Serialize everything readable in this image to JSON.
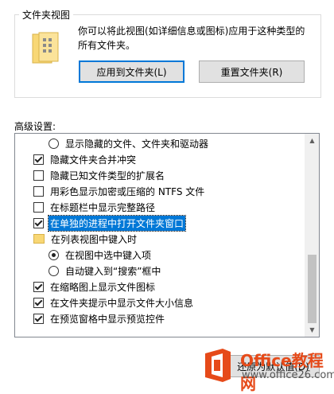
{
  "folder_view": {
    "title": "文件夹视图",
    "description": "你可以将此视图(如详细信息或图标)应用于这种类型的所有文件夹。",
    "apply_button": "应用到文件夹(L)",
    "reset_button": "重置文件夹(R)"
  },
  "advanced": {
    "label": "高级设置:",
    "items": [
      {
        "type": "radio",
        "checked": false,
        "indent": 2,
        "label": "显示隐藏的文件、文件夹和驱动器"
      },
      {
        "type": "checkbox",
        "checked": true,
        "indent": 1,
        "label": "隐藏文件夹合并冲突"
      },
      {
        "type": "checkbox",
        "checked": false,
        "indent": 1,
        "label": "隐藏已知文件类型的扩展名"
      },
      {
        "type": "checkbox",
        "checked": false,
        "indent": 1,
        "label": "用彩色显示加密或压缩的 NTFS 文件"
      },
      {
        "type": "checkbox",
        "checked": false,
        "indent": 1,
        "label": "在标题栏中显示完整路径"
      },
      {
        "type": "checkbox",
        "checked": true,
        "indent": 1,
        "label": "在单独的进程中打开文件夹窗口",
        "selected": true
      },
      {
        "type": "folder",
        "checked": false,
        "indent": 1,
        "label": "在列表视图中键入时"
      },
      {
        "type": "radio",
        "checked": true,
        "indent": 2,
        "label": "在视图中选中键入项"
      },
      {
        "type": "radio",
        "checked": false,
        "indent": 2,
        "label": "自动键入到“搜索”框中"
      },
      {
        "type": "checkbox",
        "checked": true,
        "indent": 1,
        "label": "在缩略图上显示文件图标"
      },
      {
        "type": "checkbox",
        "checked": true,
        "indent": 1,
        "label": "在文件夹提示中显示文件大小信息"
      },
      {
        "type": "checkbox",
        "checked": true,
        "indent": 1,
        "label": "在预览窗格中显示预览控件"
      }
    ],
    "restore_button": "还原为默认值(D)"
  },
  "watermark": {
    "line1": "Office教程网",
    "line2": "www.office26.com",
    "color": "#e64a19"
  }
}
